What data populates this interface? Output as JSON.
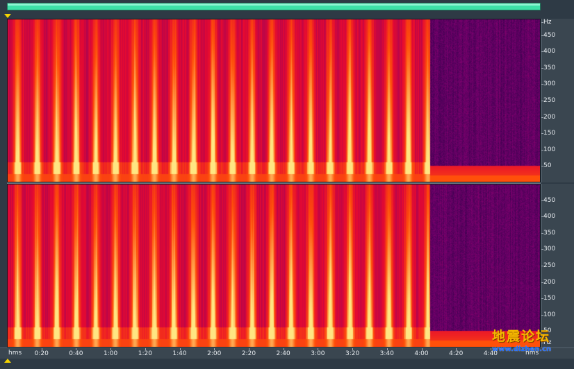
{
  "overview": {
    "color": "#3ee0a8",
    "marker_color": "#f4d400"
  },
  "frequency_axis": {
    "unit": "Hz",
    "ticks": [
      "450",
      "400",
      "350",
      "300",
      "250",
      "200",
      "150",
      "100",
      "50"
    ],
    "tick_values": [
      450,
      400,
      350,
      300,
      250,
      200,
      150,
      100,
      50
    ],
    "max": 500
  },
  "time_axis": {
    "unit_left": "hms",
    "unit_right": "hms",
    "ticks": [
      "0:20",
      "0:40",
      "1:00",
      "1:20",
      "1:40",
      "2:00",
      "2:20",
      "2:40",
      "3:00",
      "3:20",
      "3:40",
      "4:00",
      "4:20",
      "4:40"
    ],
    "tick_seconds": [
      20,
      40,
      60,
      80,
      100,
      120,
      140,
      160,
      180,
      200,
      220,
      240,
      260,
      280
    ],
    "duration_seconds": 309
  },
  "signal": {
    "active_end_seconds": 245
  },
  "watermark": {
    "text_cn": "地震论坛",
    "url": "www.dizhen.cn"
  },
  "colors": {
    "background": "#2e3a45",
    "spectrogram_hot": "#ffe08a",
    "spectrogram_mid": "#e8101a",
    "spectrogram_low": "#5a0a6e"
  }
}
